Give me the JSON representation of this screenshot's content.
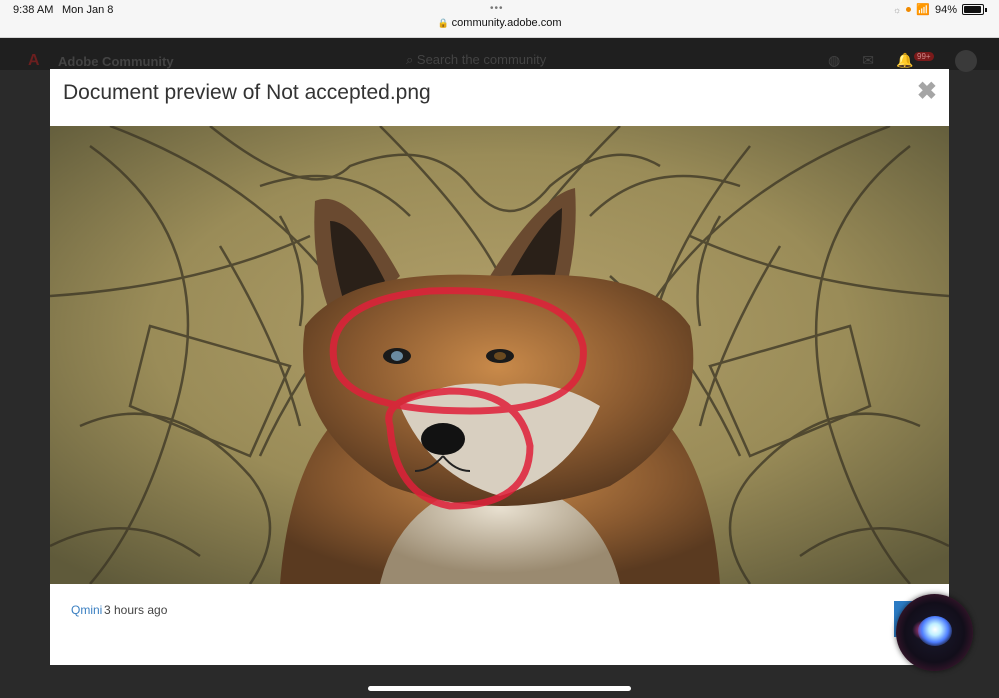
{
  "status_bar": {
    "time": "9:38 AM",
    "date": "Mon Jan 8",
    "url": "community.adobe.com",
    "battery": "94%"
  },
  "site": {
    "title": "Adobe Community",
    "search_placeholder": "Search the community",
    "notification_count": "99+"
  },
  "modal": {
    "title": "Document preview of Not accepted.png",
    "close_glyph": "✖",
    "author": "Qmini",
    "time_ago": "3 hours ago"
  },
  "icons": {
    "lock": "lock-icon",
    "close": "close-icon",
    "globe": "globe-icon",
    "mail": "mail-icon",
    "bell": "bell-icon",
    "siri": "siri-icon"
  },
  "colors": {
    "link": "#3a7fc1",
    "action": "#2b7bc4",
    "annotation": "#e0203a"
  }
}
